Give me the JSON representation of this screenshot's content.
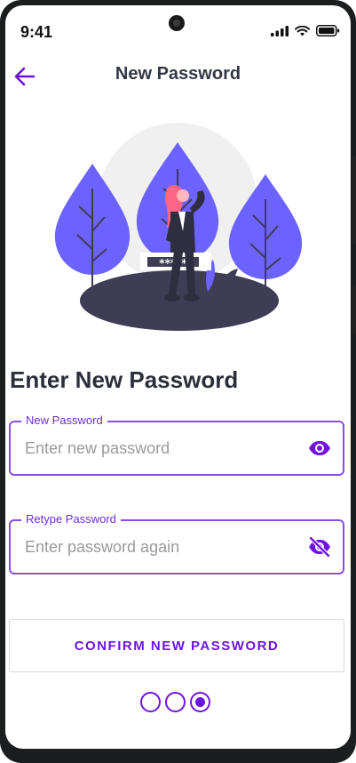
{
  "status_bar": {
    "time": "9:41"
  },
  "app_bar": {
    "title": "New Password"
  },
  "main": {
    "heading": "Enter New Password",
    "new_password": {
      "label": "New Password",
      "placeholder": "Enter new password",
      "value": ""
    },
    "retype_password": {
      "label": "Retype Password",
      "placeholder": "Enter password again",
      "value": ""
    },
    "illustration": {
      "password_mask": "*****"
    },
    "confirm_button": "CONFIRM NEW PASSWORD"
  },
  "pager": {
    "total": 3,
    "active_index": 3
  },
  "colors": {
    "accent": "#6E14E0",
    "tree": "#6C63FF",
    "ground": "#3F3D56",
    "hair": "#FF6584",
    "text_dark": "#2B2F3A"
  },
  "icons": {
    "back": "arrow-left-icon",
    "eye_open": "eye-icon",
    "eye_hidden": "eye-off-icon"
  }
}
